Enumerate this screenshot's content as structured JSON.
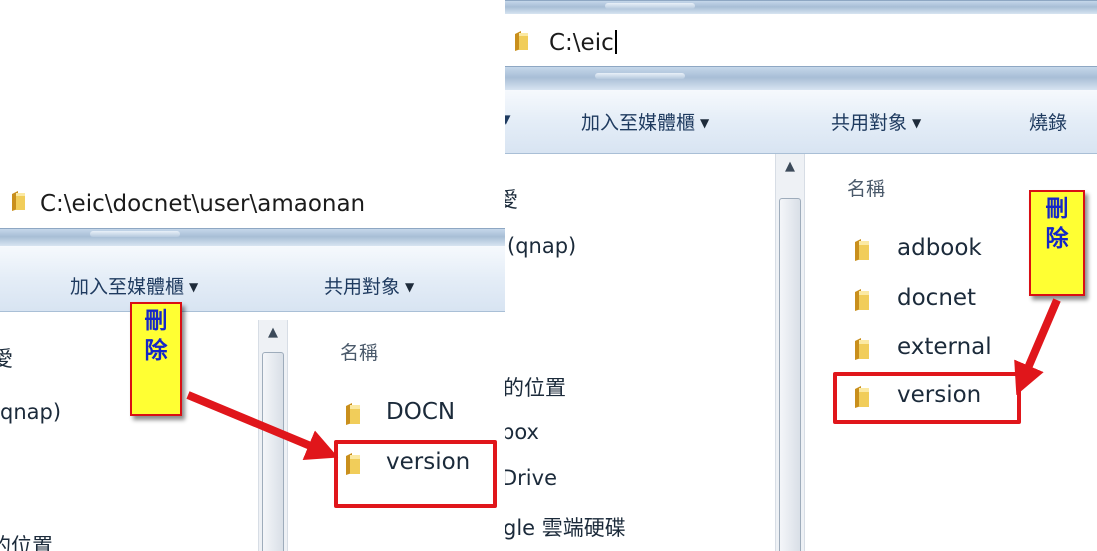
{
  "colors": {
    "accent_red": "#e0161b",
    "callout_yellow": "#ffff33",
    "callout_text": "#1426c8",
    "folder": "#e8b93a"
  },
  "left_window": {
    "address": "C:\\eic\\docnet\\user\\amaonan",
    "toolbar": {
      "library_label": "加入至媒體櫃",
      "share_label": "共用對象"
    },
    "nav_items": [
      "愛",
      "qnap)",
      "的位置"
    ],
    "column_header": "名稱",
    "files": [
      {
        "name": "DOCN",
        "icon": "folder-icon"
      },
      {
        "name": "version",
        "icon": "folder-icon"
      }
    ],
    "callout": {
      "line1": "刪",
      "line2": "除"
    }
  },
  "right_window": {
    "address": "C:\\eic",
    "toolbar": {
      "library_label": "加入至媒體櫃",
      "share_label": "共用對象",
      "burn_label": "燒錄"
    },
    "nav_items": [
      "愛",
      "(qnap)",
      "的位置",
      "box",
      "Drive",
      "gle 雲端硬碟"
    ],
    "column_header": "名稱",
    "files": [
      {
        "name": "adbook",
        "icon": "folder-icon"
      },
      {
        "name": "docnet",
        "icon": "folder-icon"
      },
      {
        "name": "external",
        "icon": "folder-icon"
      },
      {
        "name": "version",
        "icon": "folder-icon"
      }
    ],
    "callout": {
      "line1": "刪",
      "line2": "除"
    }
  }
}
